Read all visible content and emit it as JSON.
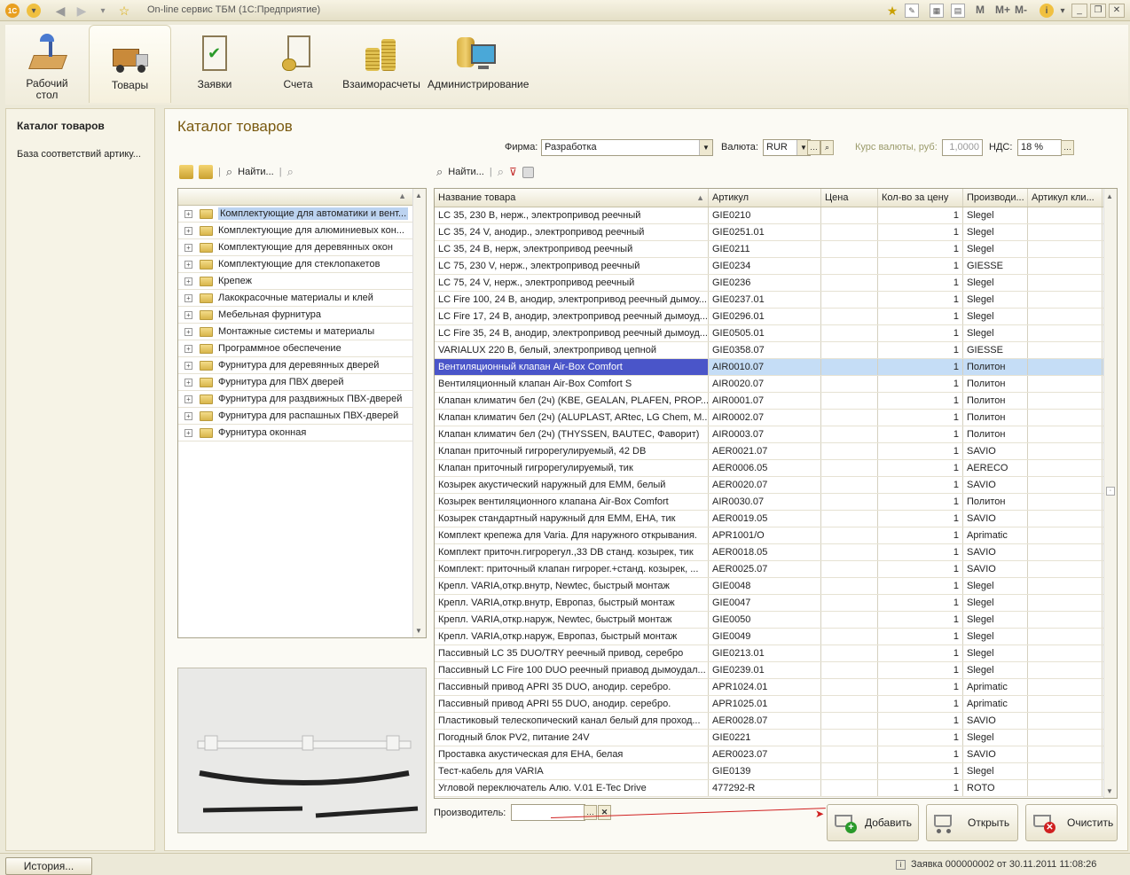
{
  "window": {
    "title": "On-line сервис ТБМ (1С:Предприятие)",
    "toolbar_right": [
      "M",
      "M+",
      "M-"
    ]
  },
  "ribbon": {
    "items": [
      {
        "label": "Рабочий\nстол",
        "icon": "desk-lamp-icon"
      },
      {
        "label": "Товары",
        "icon": "truck-boxes-icon",
        "selected": true
      },
      {
        "label": "Заявки",
        "icon": "clipboard-check-icon"
      },
      {
        "label": "Счета",
        "icon": "invoice-coins-icon"
      },
      {
        "label": "Взаиморасчеты",
        "icon": "coins-stack-icon"
      },
      {
        "label": "Администрирование",
        "icon": "monitor-database-icon"
      }
    ]
  },
  "leftpane": {
    "items": [
      "Каталог товаров",
      "База соответствий артику..."
    ]
  },
  "page": {
    "title": "Каталог товаров"
  },
  "filters": {
    "firm_label": "Фирма:",
    "firm_value": "Разработка",
    "currency_label": "Валюта:",
    "currency_value": "RUR",
    "rate_label": "Курс валюты, руб:",
    "rate_value": "1,0000",
    "vat_label": "НДС:",
    "vat_value": "18 %"
  },
  "tree_toolbar": {
    "find": "Найти..."
  },
  "grid_toolbar": {
    "find": "Найти..."
  },
  "tree": {
    "selected_index": 0,
    "items": [
      "Комплектующие для автоматики и вент...",
      "Комплектующие для алюминиевых кон...",
      "Комплектующие для деревянных окон",
      "Комплектующие для стеклопакетов",
      "Крепеж",
      "Лакокрасочные материалы и клей",
      "Мебельная фурнитура",
      "Монтажные системы и материалы",
      "Программное обеспечение",
      "Фурнитура для деревянных дверей",
      "Фурнитура для ПВХ дверей",
      "Фурнитура для раздвижных ПВХ-дверей",
      "Фурнитура для распашных ПВХ-дверей",
      "Фурнитура оконная"
    ]
  },
  "grid": {
    "columns": [
      "Название товара",
      "Артикул",
      "Цена",
      "Кол-во за цену",
      "Производи...",
      "Артикул кли..."
    ],
    "selected_index": 9,
    "rows": [
      [
        "LC 35, 230 В, нерж., электропривод реечный",
        "GIE0210",
        "",
        "1",
        "Slegel",
        ""
      ],
      [
        "LC 35, 24 V, анодир., электропривод реечный",
        "GIE0251.01",
        "",
        "1",
        "Slegel",
        ""
      ],
      [
        "LC 35, 24 В, нерж, электропривод реечный",
        "GIE0211",
        "",
        "1",
        "Slegel",
        ""
      ],
      [
        "LC 75, 230 V, нерж., электропривод реечный",
        "GIE0234",
        "",
        "1",
        "GIESSE",
        ""
      ],
      [
        "LC 75, 24 V, нерж., электропривод реечный",
        "GIE0236",
        "",
        "1",
        "Slegel",
        ""
      ],
      [
        "LC Fire 100, 24 В, анодир, электропривод реечный дымоу...",
        "GIE0237.01",
        "",
        "1",
        "Slegel",
        ""
      ],
      [
        "LC Fire 17, 24 В, анодир, электропривод реечный дымоуд...",
        "GIE0296.01",
        "",
        "1",
        "Slegel",
        ""
      ],
      [
        "LC Fire 35, 24 В, анодир, электропривод реечный дымоуд...",
        "GIE0505.01",
        "",
        "1",
        "Slegel",
        ""
      ],
      [
        "VARIALUX 220 В, белый, электропривод цепной",
        "GIE0358.07",
        "",
        "1",
        "GIESSE",
        ""
      ],
      [
        "Вентиляционный клапан Air-Box Comfort",
        "AIR0010.07",
        "",
        "1",
        "Политон",
        ""
      ],
      [
        "Вентиляционный клапан Air-Box Comfort S",
        "AIR0020.07",
        "",
        "1",
        "Политон",
        ""
      ],
      [
        "Клапан климатич бел (2ч) (KBE, GEALAN, PLAFEN, PROP...",
        "AIR0001.07",
        "",
        "1",
        "Политон",
        ""
      ],
      [
        "Клапан климатич бел (2ч) (ALUPLAST, ARtec, LG Chem, M...",
        "AIR0002.07",
        "",
        "1",
        "Политон",
        ""
      ],
      [
        "Клапан климатич бел (2ч) (THYSSEN, BAUTEC, Фаворит)",
        "AIR0003.07",
        "",
        "1",
        "Политон",
        ""
      ],
      [
        "Клапан приточный гигрорегулируемый, 42 DB",
        "AER0021.07",
        "",
        "1",
        "SAVIO",
        ""
      ],
      [
        "Клапан приточный гигрорегулируемый, тик",
        "AER0006.05",
        "",
        "1",
        "AERECO",
        ""
      ],
      [
        "Козырек акустический наружный для EMM, белый",
        "AER0020.07",
        "",
        "1",
        "SAVIO",
        ""
      ],
      [
        "Козырек вентиляционного клапана Air-Box Comfort",
        "AIR0030.07",
        "",
        "1",
        "Политон",
        ""
      ],
      [
        "Козырек стандартный наружный для EMM, EHA, тик",
        "AER0019.05",
        "",
        "1",
        "SAVIO",
        ""
      ],
      [
        "Комплект крепежа для Varia. Для наружного открывания.",
        "APR1001/O",
        "",
        "1",
        "Aprimatic",
        ""
      ],
      [
        "Комплект приточн.гигрорегул.,33 DB станд. козырек, тик",
        "AER0018.05",
        "",
        "1",
        "SAVIO",
        ""
      ],
      [
        "Комплект: приточный клапан гигрорег.+станд. козырек, ...",
        "AER0025.07",
        "",
        "1",
        "SAVIO",
        ""
      ],
      [
        "Крепл. VARIA,откр.внутр, Newtec, быстрый монтаж",
        "GIE0048",
        "",
        "1",
        "Slegel",
        ""
      ],
      [
        "Крепл. VARIA,откр.внутр, Европаз, быстрый монтаж",
        "GIE0047",
        "",
        "1",
        "Slegel",
        ""
      ],
      [
        "Крепл. VARIA,откр.наруж, Newtec, быстрый монтаж",
        "GIE0050",
        "",
        "1",
        "Slegel",
        ""
      ],
      [
        "Крепл. VARIA,откр.наруж, Европаз, быстрый монтаж",
        "GIE0049",
        "",
        "1",
        "Slegel",
        ""
      ],
      [
        "Пассивный LC 35 DUO/TRY реечный привод, серебро",
        "GIE0213.01",
        "",
        "1",
        "Slegel",
        ""
      ],
      [
        "Пассивный LC Fire 100 DUO реечный приавод дымоудал...",
        "GIE0239.01",
        "",
        "1",
        "Slegel",
        ""
      ],
      [
        "Пассивный привод APRI 35 DUO, анодир. серебро.",
        "APR1024.01",
        "",
        "1",
        "Aprimatic",
        ""
      ],
      [
        "Пассивный привод APRI 55 DUO, анодир. серебро.",
        "APR1025.01",
        "",
        "1",
        "Aprimatic",
        ""
      ],
      [
        "Пластиковый телескопический канал белый для проход...",
        "AER0028.07",
        "",
        "1",
        "SAVIO",
        ""
      ],
      [
        "Погодный блок PV2, питание 24V",
        "GIE0221",
        "",
        "1",
        "Slegel",
        ""
      ],
      [
        "Проставка акустическая для EHA, белая",
        "AER0023.07",
        "",
        "1",
        "SAVIO",
        ""
      ],
      [
        "Тест-кабель для VARIA",
        "GIE0139",
        "",
        "1",
        "Slegel",
        ""
      ],
      [
        "Угловой переключатель Алю. V.01 E-Tec Drive",
        "477292-R",
        "",
        "1",
        "ROTO",
        ""
      ]
    ]
  },
  "bottom": {
    "producer_label": "Производитель:",
    "producer_value": "",
    "add": "Добавить",
    "open": "Открыть",
    "clear": "Очистить"
  },
  "statusbar": {
    "history": "История...",
    "status": "Заявка 000000002 от 30.11.2011 11:08:26"
  }
}
